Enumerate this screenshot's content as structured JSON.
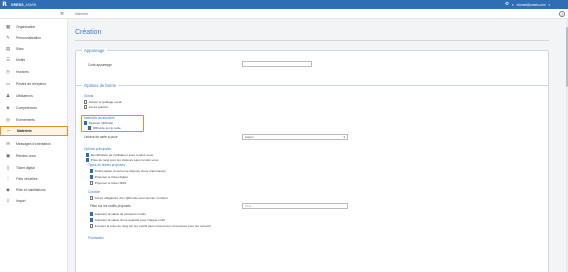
{
  "topbar": {
    "logo": "R",
    "app_name": "ORESIS",
    "app_sub": "_ADMIN",
    "user": "chomel@oresis.com",
    "gear_icon": "gear-icon"
  },
  "breadcrumb": "Matériels",
  "sidebar": {
    "items": [
      {
        "label": "Organisation",
        "icon": "building-icon"
      },
      {
        "label": "Personnalisation",
        "icon": "brush-icon"
      },
      {
        "label": "Sites",
        "icon": "sites-icon"
      },
      {
        "label": "Motifs",
        "icon": "list-icon"
      },
      {
        "label": "Horaires",
        "icon": "clock-icon"
      },
      {
        "label": "Postes de réception",
        "icon": "desk-icon"
      },
      {
        "label": "Utilisateurs",
        "icon": "user-icon"
      },
      {
        "label": "Compétences",
        "icon": "skills-icon"
      },
      {
        "label": "Evènements",
        "icon": "events-icon"
      },
      {
        "label": "Matériels",
        "icon": "device-icon"
      },
      {
        "label": "Messages d'orientation",
        "icon": "message-icon"
      },
      {
        "label": "Rendez-vous",
        "icon": "calendar-icon"
      },
      {
        "label": "Ticket digital",
        "icon": "ticket-icon"
      },
      {
        "label": "Files virtuelles",
        "icon": "queue-icon"
      },
      {
        "label": "Rôle et habilitations",
        "icon": "shield-icon"
      },
      {
        "label": "Import",
        "icon": "import-icon"
      }
    ],
    "active_index": 9
  },
  "page": {
    "title": "Création",
    "appareage": {
      "legend": "Appareage",
      "code_label": "Code appareage",
      "code_value": ""
    },
    "options": {
      "legend": "Options de borne",
      "global_title": "Global",
      "global_items": [
        {
          "label": "Activer le guidage vocal",
          "checked": false
        },
        {
          "label": "Accès guichet",
          "checked": false
        }
      ],
      "materials_title": "Matériels accessoires",
      "materials_items": [
        {
          "label": "Scanner QRCode",
          "checked": true
        },
        {
          "label": "QRCode sur le code",
          "checked": true
        }
      ],
      "reader_label": "Lecteur de carte à puce",
      "reader_value": "Aucun",
      "main_title": "Options principales",
      "main_items": [
        {
          "label": "Identification de l'utilisateur avec rendez-vous",
          "checked": true
        },
        {
          "label": "Prise de rang pour les visiteurs sans rendez-vous",
          "checked": true
        }
      ],
      "ticket_types_title": "Types de tickets proposés",
      "ticket_items": [
        {
          "label": "Ticket papier (si la borne dispose d'une imprimante)",
          "checked": true
        },
        {
          "label": "Proposer le ticket digital",
          "checked": true
        },
        {
          "label": "Proposer le ticket SMS",
          "checked": false
        }
      ],
      "control_title": "Contrôle",
      "control_items": [
        {
          "label": "Accès obligatoire d'un QRCode pour donner un ticket",
          "checked": false
        }
      ],
      "filter_label": "Filtre sur les motifs proposés",
      "filter_placeholder": "Tous",
      "control_items2": [
        {
          "label": "Autoriser la saisie de plusieurs motifs",
          "checked": true
        },
        {
          "label": "Autoriser la saisie d'une quantité pour chaque motif",
          "checked": true
        },
        {
          "label": "Imposer la prise de rang sur les motifs sans ressources connectées pour les recevoir",
          "checked": false
        }
      ],
      "prioritization_title": "Priorisation"
    }
  }
}
